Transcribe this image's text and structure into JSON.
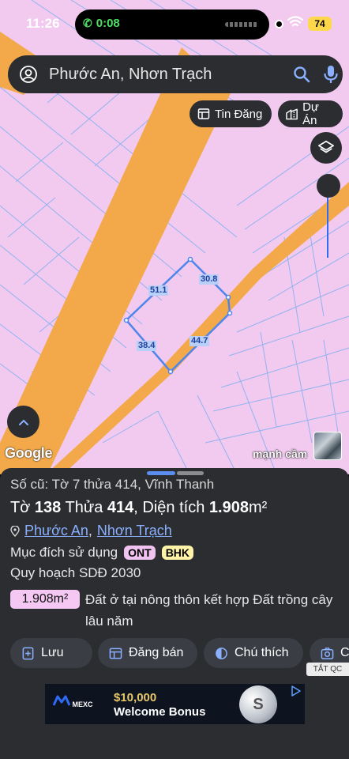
{
  "status_bar": {
    "time": "11:26",
    "call_duration": "0:08",
    "battery": "74"
  },
  "search": {
    "query": "Phước An, Nhơn Trạch"
  },
  "chips": {
    "news": "Tin Đăng",
    "projects": "Dự Án"
  },
  "map": {
    "edge_labels": [
      "51.1",
      "30.8",
      "38.4",
      "44.7"
    ],
    "attribution": "Google",
    "photo_owner": "mạnh cầm"
  },
  "sheet": {
    "old_ref": "Số cũ: Tờ 7 thửa 414, Vĩnh Thanh",
    "parcel": {
      "sheet_label": "Tờ",
      "sheet_no": "138",
      "lot_label": "Thửa",
      "lot_no": "414",
      "area_label": ", Diện tích",
      "area_value": "1.908",
      "area_unit": "m²"
    },
    "location": {
      "ward": "Phước An",
      "separator": ",",
      "district": "Nhơn Trạch"
    },
    "purpose_label": "Mục đích sử dụng",
    "purpose_codes": [
      "ONT",
      "BHK"
    ],
    "plan_label": "Quy hoạch SDĐ 2030",
    "area_badge": "1.908m²",
    "land_description": "Đất ở tại nông thôn kết hợp Đất trồng cây lâu năm",
    "actions": {
      "save": "Lưu",
      "post": "Đăng bán",
      "legend": "Chú thích",
      "camera": "C"
    },
    "ad_close": "TẮT QC",
    "ad": {
      "brand": "MEXC",
      "amount": "$10,000",
      "text": "Welcome Bonus"
    }
  },
  "colors": {
    "map_bg": "#f2c9ef",
    "road": "#f3a94a",
    "panel": "#2b2d31",
    "accent": "#5b8def"
  }
}
